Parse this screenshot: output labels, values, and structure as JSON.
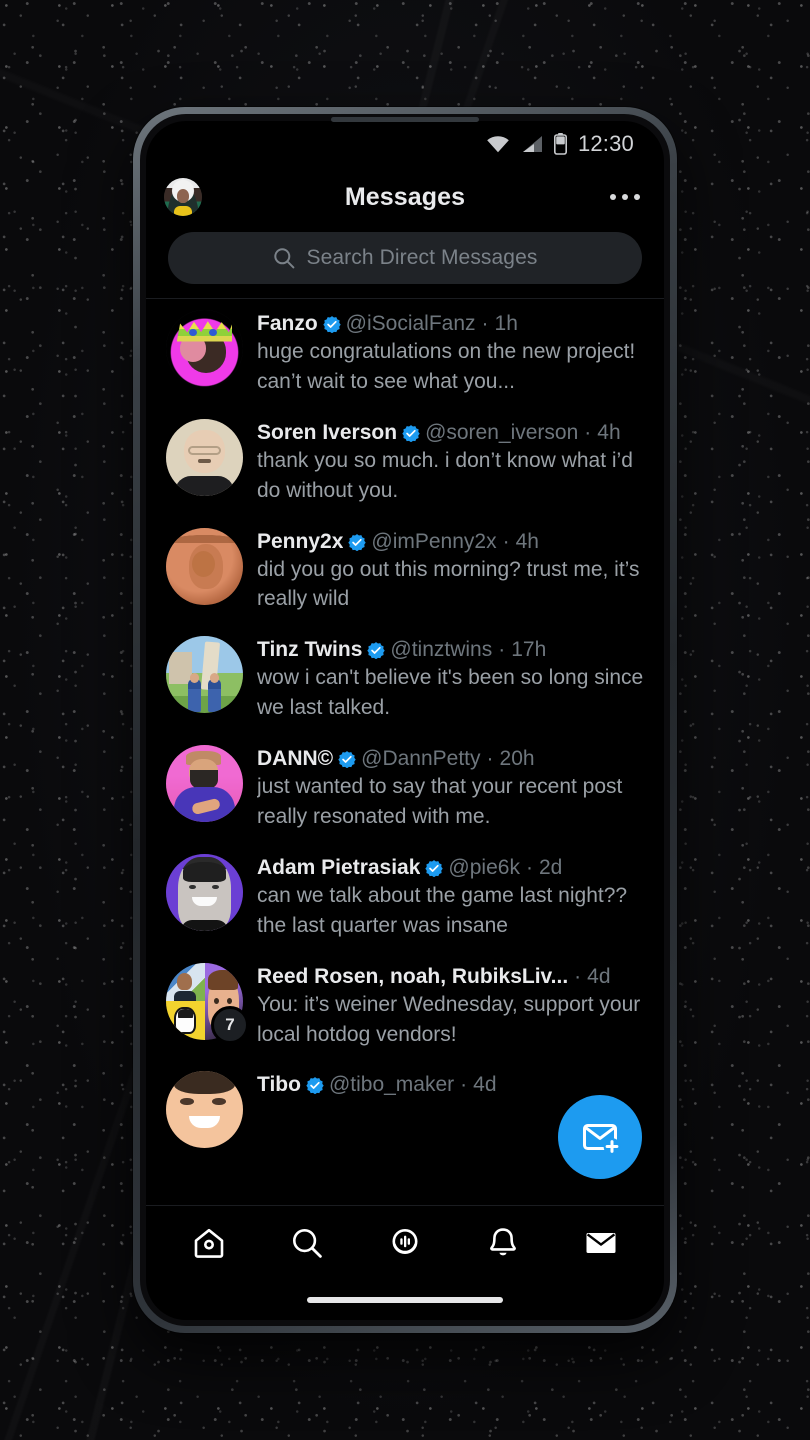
{
  "statusbar": {
    "time": "12:30",
    "icons": [
      "wifi-icon",
      "cellular-signal-icon",
      "battery-icon"
    ]
  },
  "header": {
    "title": "Messages",
    "avatar_name": "profile-avatar",
    "more_label": "more-options"
  },
  "search": {
    "placeholder": "Search Direct Messages",
    "icon": "search-icon"
  },
  "colors": {
    "accent": "#1D9BF0",
    "verified_blue": "#1D9BF0",
    "screen_bg": "#000000",
    "search_bg": "#202327",
    "name_text": "#E9EAEC",
    "muted_text": "#6E767D",
    "preview_text": "#9AA0A6",
    "frame": "#3A4046"
  },
  "conversations": [
    {
      "name": "Fanzo",
      "verified": true,
      "handle": "@iSocialFanz",
      "time": "1h",
      "preview": "huge congratulations on the new project! can’t wait to see what you...",
      "avatar": "fanzo-avatar"
    },
    {
      "name": "Soren Iverson",
      "verified": true,
      "handle": "@soren_iverson",
      "time": "4h",
      "preview": "thank you so much. i don’t know what i’d do without you.",
      "avatar": "soren-iverson-avatar"
    },
    {
      "name": "Penny2x",
      "verified": true,
      "handle": "@imPenny2x",
      "time": "4h",
      "preview": "did you go out this morning? trust me, it’s really wild",
      "avatar": "penny2x-avatar"
    },
    {
      "name": "Tinz Twins",
      "verified": true,
      "handle": "@tinztwins",
      "time": "17h",
      "preview": "wow i can't believe it's been so long since we last talked.",
      "avatar": "tinz-twins-avatar"
    },
    {
      "name": "DANN©",
      "verified": true,
      "handle": "@DannPetty",
      "time": "20h",
      "preview": "just wanted to say that your recent post really resonated with me.",
      "avatar": "dann-avatar"
    },
    {
      "name": "Adam Pietrasiak",
      "verified": true,
      "handle": "@pie6k",
      "time": "2d",
      "preview": "can we talk about the game last night?? the last quarter was insane",
      "avatar": "adam-pietrasiak-avatar"
    },
    {
      "name": "Reed Rosen, noah, RubiksLiv...",
      "verified": false,
      "handle": "",
      "time": "4d",
      "preview": "You: it’s weiner Wednesday, support your local hotdog vendors!",
      "avatar": "group-avatar",
      "group_count": "7"
    },
    {
      "name": "Tibo",
      "verified": true,
      "handle": "@tibo_maker",
      "time": "4d",
      "preview": "",
      "avatar": "tibo-avatar"
    }
  ],
  "fab": {
    "label": "new-message",
    "icon": "new-message-envelope-icon"
  },
  "navbar": {
    "items": [
      {
        "name": "home",
        "icon": "home-icon"
      },
      {
        "name": "explore",
        "icon": "search-icon"
      },
      {
        "name": "spaces",
        "icon": "spaces-microphone-icon"
      },
      {
        "name": "notifications",
        "icon": "bell-icon"
      },
      {
        "name": "messages",
        "icon": "envelope-icon"
      }
    ]
  }
}
